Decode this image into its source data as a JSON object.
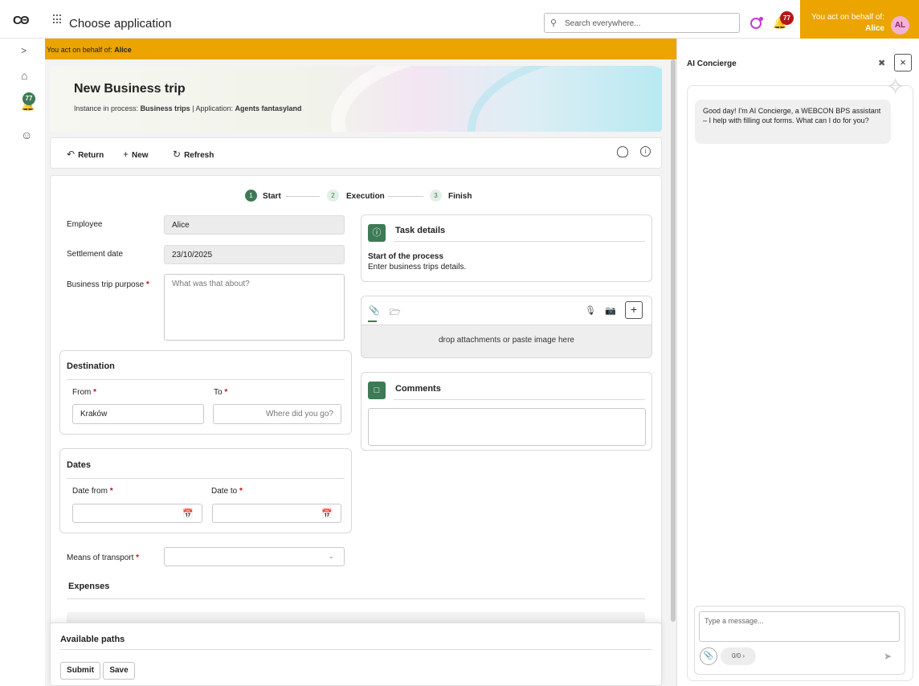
{
  "topbar": {
    "logo": "CΘ",
    "title": "Choose application",
    "search_placeholder": "Search everywhere...",
    "notifications_count": "77",
    "behalf_label": "You act on behalf of:",
    "behalf_name": "Alice",
    "avatar_initials": "AL"
  },
  "rail": {
    "expand": ">",
    "notifications_count": "77"
  },
  "banner": {
    "prefix": "You act on behalf of:",
    "name": "Alice"
  },
  "hero": {
    "title": "New Business trip",
    "instance_label": "Instance in process:",
    "instance_value": "Business trips",
    "app_label": "| Application:",
    "app_value": "Agents fantasyland"
  },
  "toolbar": {
    "return": "Return",
    "new": "New",
    "refresh": "Refresh"
  },
  "steps": [
    {
      "num": "1",
      "label": "Start"
    },
    {
      "num": "2",
      "label": "Execution"
    },
    {
      "num": "3",
      "label": "Finish"
    }
  ],
  "form": {
    "employee_label": "Employee",
    "employee_value": "Alice",
    "settlement_label": "Settlement date",
    "settlement_value": "23/10/2025",
    "purpose_label": "Business trip purpose",
    "purpose_placeholder": "What was that about?",
    "destination_title": "Destination",
    "from_label": "From",
    "from_value": "Kraków",
    "to_label": "To",
    "to_placeholder": "Where did you go?",
    "dates_title": "Dates",
    "date_from_label": "Date from",
    "date_to_label": "Date to",
    "transport_label": "Means of transport",
    "expenses_title": "Expenses",
    "required_mark": "*"
  },
  "task": {
    "title": "Task details",
    "heading": "Start of the process",
    "text": "Enter business trips details."
  },
  "attachments": {
    "drop_text": "drop attachments or paste image here"
  },
  "comments": {
    "title": "Comments"
  },
  "paths": {
    "title": "Available paths",
    "submit": "Submit",
    "save": "Save"
  },
  "concierge": {
    "title": "AI Concierge",
    "greeting": "Good day! I'm AI Concierge, a WEBCON BPS assistant – I help with filling out forms. What can I do for you?",
    "input_placeholder": "Type a message...",
    "counter": "0/0"
  }
}
